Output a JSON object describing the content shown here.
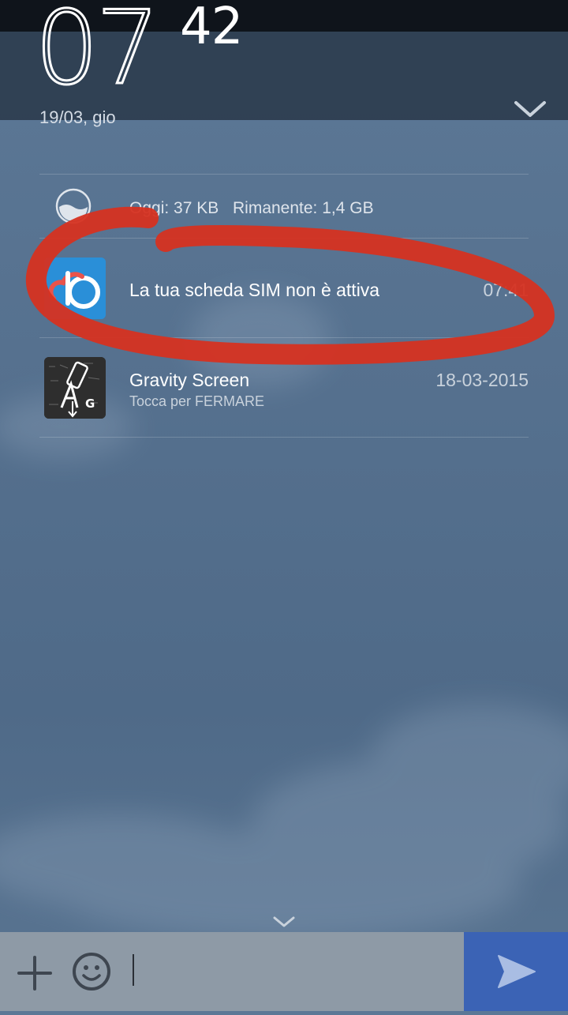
{
  "clock": {
    "hours": "07",
    "minutes": "42",
    "date": "19/03, gio"
  },
  "data_usage": {
    "today": "Oggi: 37 KB",
    "remaining": "Rimanente: 1,4 GB"
  },
  "notifications": [
    {
      "app": "sim-app",
      "title": "La tua scheda SIM non è attiva",
      "time": "07:41"
    },
    {
      "app": "gravity-screen",
      "title": "Gravity Screen",
      "subtitle": "Tocca per FERMARE",
      "time": "18-03-2015"
    }
  ],
  "icons": {
    "collapse": "chevron-up-icon",
    "expand": "chevron-down-icon",
    "add": "plus-icon",
    "emoji": "smiley-icon",
    "send": "send-icon",
    "data": "data-usage-icon"
  },
  "colors": {
    "annotation": "#d63221",
    "send_button": "#3b63b5",
    "input_bar": "#8e9aa6",
    "sim_app_icon": "#2a8fd8"
  }
}
